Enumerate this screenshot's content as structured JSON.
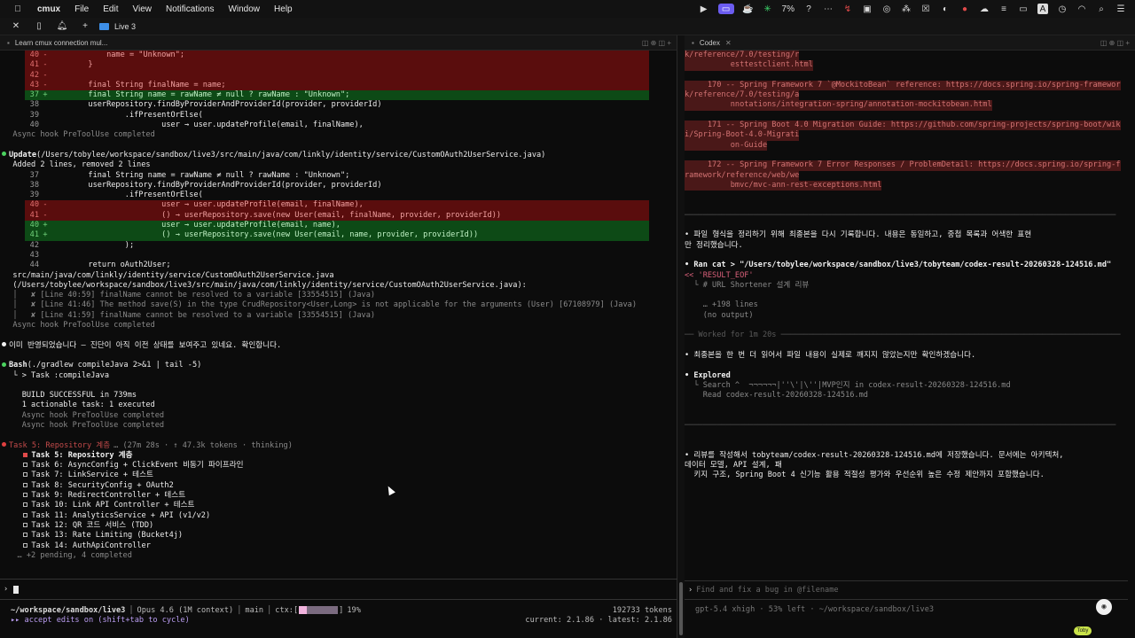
{
  "menubar": {
    "app": "cmux",
    "items": [
      "File",
      "Edit",
      "View",
      "Notifications",
      "Window",
      "Help"
    ],
    "battery_pct": "7%",
    "right_icons": [
      "play-icon",
      "screen-icon",
      "coffee-icon",
      "spark-icon",
      "lightbulb-icon",
      "dots-icon",
      "bolt-icon",
      "photo-icon",
      "target-icon",
      "grid-icon",
      "x-box-icon",
      "leaf-icon",
      "record-icon",
      "cloud-icon",
      "sliders-icon",
      "display-icon",
      "search-icon",
      "wifi-icon",
      "control-icon"
    ],
    "input_letter": "A"
  },
  "window": {
    "live_tab": "Live 3"
  },
  "left_pane": {
    "tab_title": "Learn cmux connection mul...",
    "lines": [
      {
        "t": "del",
        "n": "40",
        "m": "-",
        "code": "            name = \"Unknown\";"
      },
      {
        "t": "del",
        "n": "41",
        "m": "-",
        "code": "        }"
      },
      {
        "t": "del",
        "n": "42",
        "m": "-",
        "code": ""
      },
      {
        "t": "del",
        "n": "43",
        "m": "-",
        "code": "        final String finalName = name;"
      },
      {
        "t": "add",
        "n": "37",
        "m": "+",
        "code": "        final String name = rawName ≠ null ? rawName : \"Unknown\";"
      },
      {
        "t": "ctx",
        "n": "38",
        "m": "",
        "code": "        userRepository.findByProviderAndProviderId(provider, providerId)"
      },
      {
        "t": "ctx",
        "n": "39",
        "m": "",
        "code": "                .ifPresentOrElse("
      },
      {
        "t": "ctx",
        "n": "40",
        "m": "",
        "code": "                        user → user.updateProfile(email, finalName),"
      },
      {
        "t": "hook",
        "code": "  Async hook PreToolUse completed"
      },
      {
        "t": "blank",
        "code": ""
      },
      {
        "t": "update",
        "label": "Update",
        "path": "(/Users/tobylee/workspace/sandbox/live3/src/main/java/com/linkly/identity/service/CustomOAuth2UserService.java)"
      },
      {
        "t": "note",
        "code": "  Added 2 lines, removed 2 lines"
      },
      {
        "t": "ctx",
        "n": "37",
        "m": "",
        "code": "        final String name = rawName ≠ null ? rawName : \"Unknown\";"
      },
      {
        "t": "ctx",
        "n": "38",
        "m": "",
        "code": "        userRepository.findByProviderAndProviderId(provider, providerId)"
      },
      {
        "t": "ctx",
        "n": "39",
        "m": "",
        "code": "                .ifPresentOrElse("
      },
      {
        "t": "del",
        "n": "40",
        "m": "-",
        "code": "                        user → user.updateProfile(email, finalName),"
      },
      {
        "t": "del",
        "n": "41",
        "m": "-",
        "code": "                        () → userRepository.save(new User(email, finalName, provider, providerId))"
      },
      {
        "t": "add",
        "n": "40",
        "m": "+",
        "code": "                        user → user.updateProfile(email, name),"
      },
      {
        "t": "add",
        "n": "41",
        "m": "+",
        "code": "                        () → userRepository.save(new User(email, name, provider, providerId))"
      },
      {
        "t": "ctx",
        "n": "42",
        "m": "",
        "code": "                );"
      },
      {
        "t": "ctx",
        "n": "43",
        "m": "",
        "code": ""
      },
      {
        "t": "ctx",
        "n": "44",
        "m": "",
        "code": "        return oAuth2User;"
      },
      {
        "t": "note",
        "code": "  src/main/java/com/linkly/identity/service/CustomOAuth2UserService.java"
      },
      {
        "t": "note",
        "code": "  (/Users/tobylee/workspace/sandbox/live3/src/main/java/com/linkly/identity/service/CustomOAuth2UserService.java):"
      },
      {
        "t": "err",
        "code": "  │   ✘ [Line 40:59] finalName cannot be resolved to a variable [33554515] (Java)"
      },
      {
        "t": "err",
        "code": "  │   ✘ [Line 41:46] The method save(S) in the type CrudRepository<User,Long> is not applicable for the arguments (User) [67108979] (Java)"
      },
      {
        "t": "err",
        "code": "  │   ✘ [Line 41:59] finalName cannot be resolved to a variable [33554515] (Java)"
      },
      {
        "t": "hook",
        "code": "  Async hook PreToolUse completed"
      },
      {
        "t": "blank",
        "code": ""
      },
      {
        "t": "msg",
        "code": "이미 반영되었습니다 — 진단이 아직 이전 상태를 보여주고 있네요. 확인합니다."
      },
      {
        "t": "blank",
        "code": ""
      },
      {
        "t": "bash",
        "label": "Bash",
        "cmd": "(./gradlew compileJava 2>&1 | tail -5)"
      },
      {
        "t": "note",
        "code": "  └ > Task :compileJava"
      },
      {
        "t": "blank",
        "code": ""
      },
      {
        "t": "plain",
        "code": "    BUILD SUCCESSFUL in 739ms"
      },
      {
        "t": "plain",
        "code": "    1 actionable task: 1 executed"
      },
      {
        "t": "hook",
        "code": "    Async hook PreToolUse completed"
      },
      {
        "t": "hook",
        "code": "    Async hook PreToolUse completed"
      },
      {
        "t": "blank",
        "code": ""
      },
      {
        "t": "taskhdr",
        "label": "Task 5: Repository 계층",
        "meta": "… (27m 28s · ↑ 47.3k tokens · thinking)"
      },
      {
        "t": "task",
        "done": true,
        "code": "Task 5: Repository 계층"
      },
      {
        "t": "task",
        "done": false,
        "code": "Task 6: AsyncConfig + ClickEvent 비동기 파이프라인"
      },
      {
        "t": "task",
        "done": false,
        "code": "Task 7: LinkService + 테스트"
      },
      {
        "t": "task",
        "done": false,
        "code": "Task 8: SecurityConfig + OAuth2"
      },
      {
        "t": "task",
        "done": false,
        "code": "Task 9: RedirectController + 테스트"
      },
      {
        "t": "task",
        "done": false,
        "code": "Task 10: Link API Controller + 테스트"
      },
      {
        "t": "task",
        "done": false,
        "code": "Task 11: AnalyticsService + API (v1/v2)"
      },
      {
        "t": "task",
        "done": false,
        "code": "Task 12: QR 코드 서비스 (TDD)"
      },
      {
        "t": "task",
        "done": false,
        "code": "Task 13: Rate Limiting (Bucket4j)"
      },
      {
        "t": "task",
        "done": false,
        "code": "Task 14: AuthApiController"
      },
      {
        "t": "pending",
        "code": "   … +2 pending, 4 completed"
      }
    ],
    "status": {
      "cwd": "~/workspace/sandbox/live3",
      "model": "Opus 4.6 (1M context)",
      "branch": "main",
      "ctx_label": "ctx:",
      "ctx_pct": "19%",
      "ctx_fraction": 0.19,
      "tokens": "192733 tokens",
      "mode": "▸▸ accept edits on (shift+tab to cycle)",
      "version": "current: 2.1.86 · latest: 2.1.86"
    }
  },
  "right_pane": {
    "tab_title": "Codex",
    "lines": [
      {
        "t": "ref",
        "code": "k/reference/7.0/testing/r"
      },
      {
        "t": "ref",
        "code": "          esttestclient.html"
      },
      {
        "t": "blank",
        "code": ""
      },
      {
        "t": "ref",
        "code": "     170 -- Spring Framework 7 `@MockitoBean` reference: https://docs.spring.io/spring-framewor"
      },
      {
        "t": "ref",
        "code": "k/reference/7.0/testing/a"
      },
      {
        "t": "ref",
        "code": "          nnotations/integration-spring/annotation-mockitobean.html"
      },
      {
        "t": "blank",
        "code": ""
      },
      {
        "t": "ref",
        "code": "     171 -- Spring Boot 4.0 Migration Guide: https://github.com/spring-projects/spring-boot/wik"
      },
      {
        "t": "ref",
        "code": "i/Spring-Boot-4.0-Migrati"
      },
      {
        "t": "ref",
        "code": "          on-Guide"
      },
      {
        "t": "blank",
        "code": ""
      },
      {
        "t": "ref",
        "code": "     172 -- Spring Framework 7 Error Responses / ProblemDetail: https://docs.spring.io/spring-f"
      },
      {
        "t": "ref",
        "code": "ramework/reference/web/we"
      },
      {
        "t": "ref",
        "code": "          bmvc/mvc-ann-rest-exceptions.html"
      },
      {
        "t": "blank",
        "code": ""
      },
      {
        "t": "blank",
        "code": ""
      },
      {
        "t": "sep",
        "code": "──────────────────────────────────────────────────────────────────────────────────────────────"
      },
      {
        "t": "blank",
        "code": ""
      },
      {
        "t": "text",
        "code": "• 파일 형식을 정리하기 위해 최종본을 다시 기록합니다. 내용은 동일하고, 중첩 목록과 어색한 표현"
      },
      {
        "t": "text",
        "code": "만 정리했습니다."
      },
      {
        "t": "blank",
        "code": ""
      },
      {
        "t": "ran",
        "code": "• Ran cat > \"/Users/tobylee/workspace/sandbox/live3/tobyteam/codex-result-20260328-124516.md\""
      },
      {
        "t": "ranb",
        "code": "<< 'RESULT_EOF'"
      },
      {
        "t": "dim",
        "code": "  └ # URL Shortener 설계 리뷰"
      },
      {
        "t": "blank",
        "code": ""
      },
      {
        "t": "dim",
        "code": "    … +198 lines"
      },
      {
        "t": "dim",
        "code": "    (no output)"
      },
      {
        "t": "blank",
        "code": ""
      },
      {
        "t": "sep",
        "code": "── Worked for 1m 20s ──────────────────────────────────────────────────────────────────────────"
      },
      {
        "t": "blank",
        "code": ""
      },
      {
        "t": "text",
        "code": "• 최종본을 한 번 더 읽어서 파일 내용이 실제로 깨지지 않았는지만 확인하겠습니다."
      },
      {
        "t": "blank",
        "code": ""
      },
      {
        "t": "explored",
        "code": "• Explored"
      },
      {
        "t": "dim",
        "code": "  └ Search ^  ¬¬¬¬¬¬|''\\'|\\''|MVP인지 in codex-result-20260328-124516.md"
      },
      {
        "t": "dim",
        "code": "    Read codex-result-20260328-124516.md"
      },
      {
        "t": "blank",
        "code": ""
      },
      {
        "t": "blank",
        "code": ""
      },
      {
        "t": "sep",
        "code": "──────────────────────────────────────────────────────────────────────────────────────────────"
      },
      {
        "t": "blank",
        "code": ""
      },
      {
        "t": "blank",
        "code": ""
      },
      {
        "t": "text",
        "code": "• 리뷰를 작성해서 tobyteam/codex-result-20260328-124516.md에 저장했습니다. 문서에는 아키텍처,"
      },
      {
        "t": "text",
        "code": "데이터 모델, API 설계, 패"
      },
      {
        "t": "text",
        "code": "  키지 구조, Spring Boot 4 신기능 활용 적절성 평가와 우선순위 높은 수정 제안까지 포함했습니다."
      }
    ],
    "prompt_placeholder": "Find and fix a bug in @filename",
    "status": "gpt-5.4 xhigh · 53% left · ~/workspace/sandbox/live3"
  },
  "badge": "Toby"
}
